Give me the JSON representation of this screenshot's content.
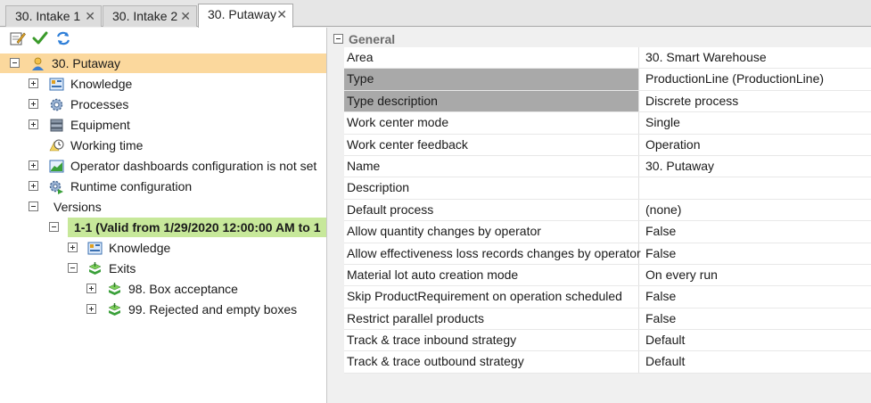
{
  "tabs": [
    {
      "label": "30. Intake 1",
      "active": false
    },
    {
      "label": "30. Intake 2",
      "active": false
    },
    {
      "label": "30. Putaway",
      "active": true
    }
  ],
  "toolbar": {
    "icons": [
      "edit-icon",
      "check-icon",
      "refresh-icon"
    ]
  },
  "tree": {
    "root": "30. Putaway",
    "knowledge": "Knowledge",
    "processes": "Processes",
    "equipment": "Equipment",
    "working_time": "Working time",
    "operator_dashboards": "Operator dashboards configuration is not set",
    "runtime_configuration": "Runtime configuration",
    "versions": "Versions",
    "version_item": "1-1 (Valid from 1/29/2020 12:00:00 AM to 1",
    "version_knowledge": "Knowledge",
    "exits": "Exits",
    "exit_1": "98. Box acceptance",
    "exit_2": "99. Rejected and empty boxes"
  },
  "properties": {
    "section_title": "General",
    "rows": [
      {
        "name": "Area",
        "value": "30. Smart Warehouse"
      },
      {
        "name": "Type",
        "value": "ProductionLine (ProductionLine)"
      },
      {
        "name": "Type description",
        "value": "Discrete process"
      },
      {
        "name": "Work center mode",
        "value": "Single"
      },
      {
        "name": "Work center feedback",
        "value": "Operation"
      },
      {
        "name": "Name",
        "value": "30. Putaway"
      },
      {
        "name": "Description",
        "value": ""
      },
      {
        "name": "Default process",
        "value": "(none)"
      },
      {
        "name": "Allow quantity changes by operator",
        "value": "False"
      },
      {
        "name": "Allow effectiveness loss records changes by operator",
        "value": "False"
      },
      {
        "name": "Material lot auto creation mode",
        "value": "On every run"
      },
      {
        "name": "Skip ProductRequirement on operation scheduled",
        "value": "False"
      },
      {
        "name": "Restrict parallel products",
        "value": "False"
      },
      {
        "name": "Track & trace inbound strategy",
        "value": "Default"
      },
      {
        "name": "Track & trace outbound strategy",
        "value": "Default"
      }
    ]
  },
  "colors": {
    "selected_row": "#fbd89d",
    "version_row": "#c7e89a",
    "highlight_property": "#a9a9a9"
  }
}
